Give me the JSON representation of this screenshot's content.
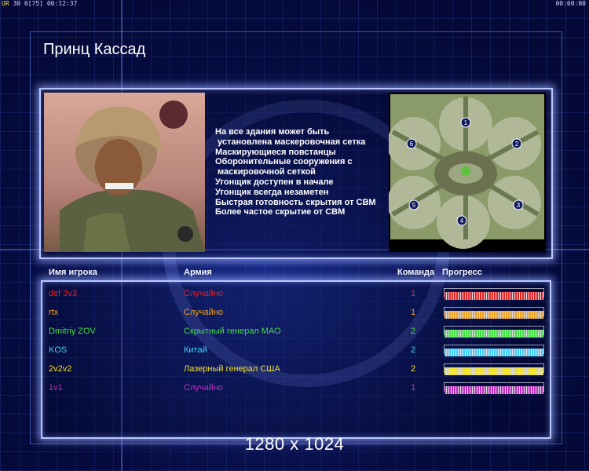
{
  "topbar": {
    "left_prefix": "UR",
    "left_values": "30 0[75]",
    "left_time": "00:12:37",
    "right_time": "00:00:00"
  },
  "title": "Принц Кассад",
  "description_lines": [
    "На все здания может быть",
    " установлена маскеровочная сетка",
    "Маскирующиеся повстанцы",
    "Оборонительные сооружения с",
    " маскировочной сеткой",
    "Угонщик доступен в начале",
    "Угонщик всегда незаметен",
    "Быстрая готовность скрытия от СВМ",
    "Более частое скрытие от СВМ"
  ],
  "table": {
    "headers": {
      "player": "Имя игрока",
      "army": "Армия",
      "team": "Команда",
      "progress": "Прогресс"
    },
    "rows": [
      {
        "name": "def 3v3",
        "army": "Случайно",
        "team": "1",
        "color": "#e82020",
        "progress": 1.0
      },
      {
        "name": "rtx",
        "army": "Случайно",
        "team": "1",
        "color": "#f0a020",
        "progress": 1.0
      },
      {
        "name": "Dmitriy ZOV",
        "army": "Скрытный генерал МАО",
        "team": "2",
        "color": "#40e040",
        "progress": 1.0
      },
      {
        "name": "KOS",
        "army": "Китай",
        "team": "2",
        "color": "#40d0ff",
        "progress": 1.0
      },
      {
        "name": "2v2v2",
        "army": "Лазерный генерал США",
        "team": "2",
        "color": "#f0e030",
        "progress": 1.0
      },
      {
        "name": "1v1",
        "army": "Случайно",
        "team": "1",
        "color": "#c030c0",
        "progress": 1.0
      }
    ]
  },
  "minimap": {
    "player_markers": [
      "1",
      "2",
      "3",
      "4",
      "5",
      "6"
    ]
  },
  "resolution_text": "1280 x 1024",
  "icons": {
    "crosshair": "crosshair-overlay",
    "portrait": "general-portrait"
  }
}
